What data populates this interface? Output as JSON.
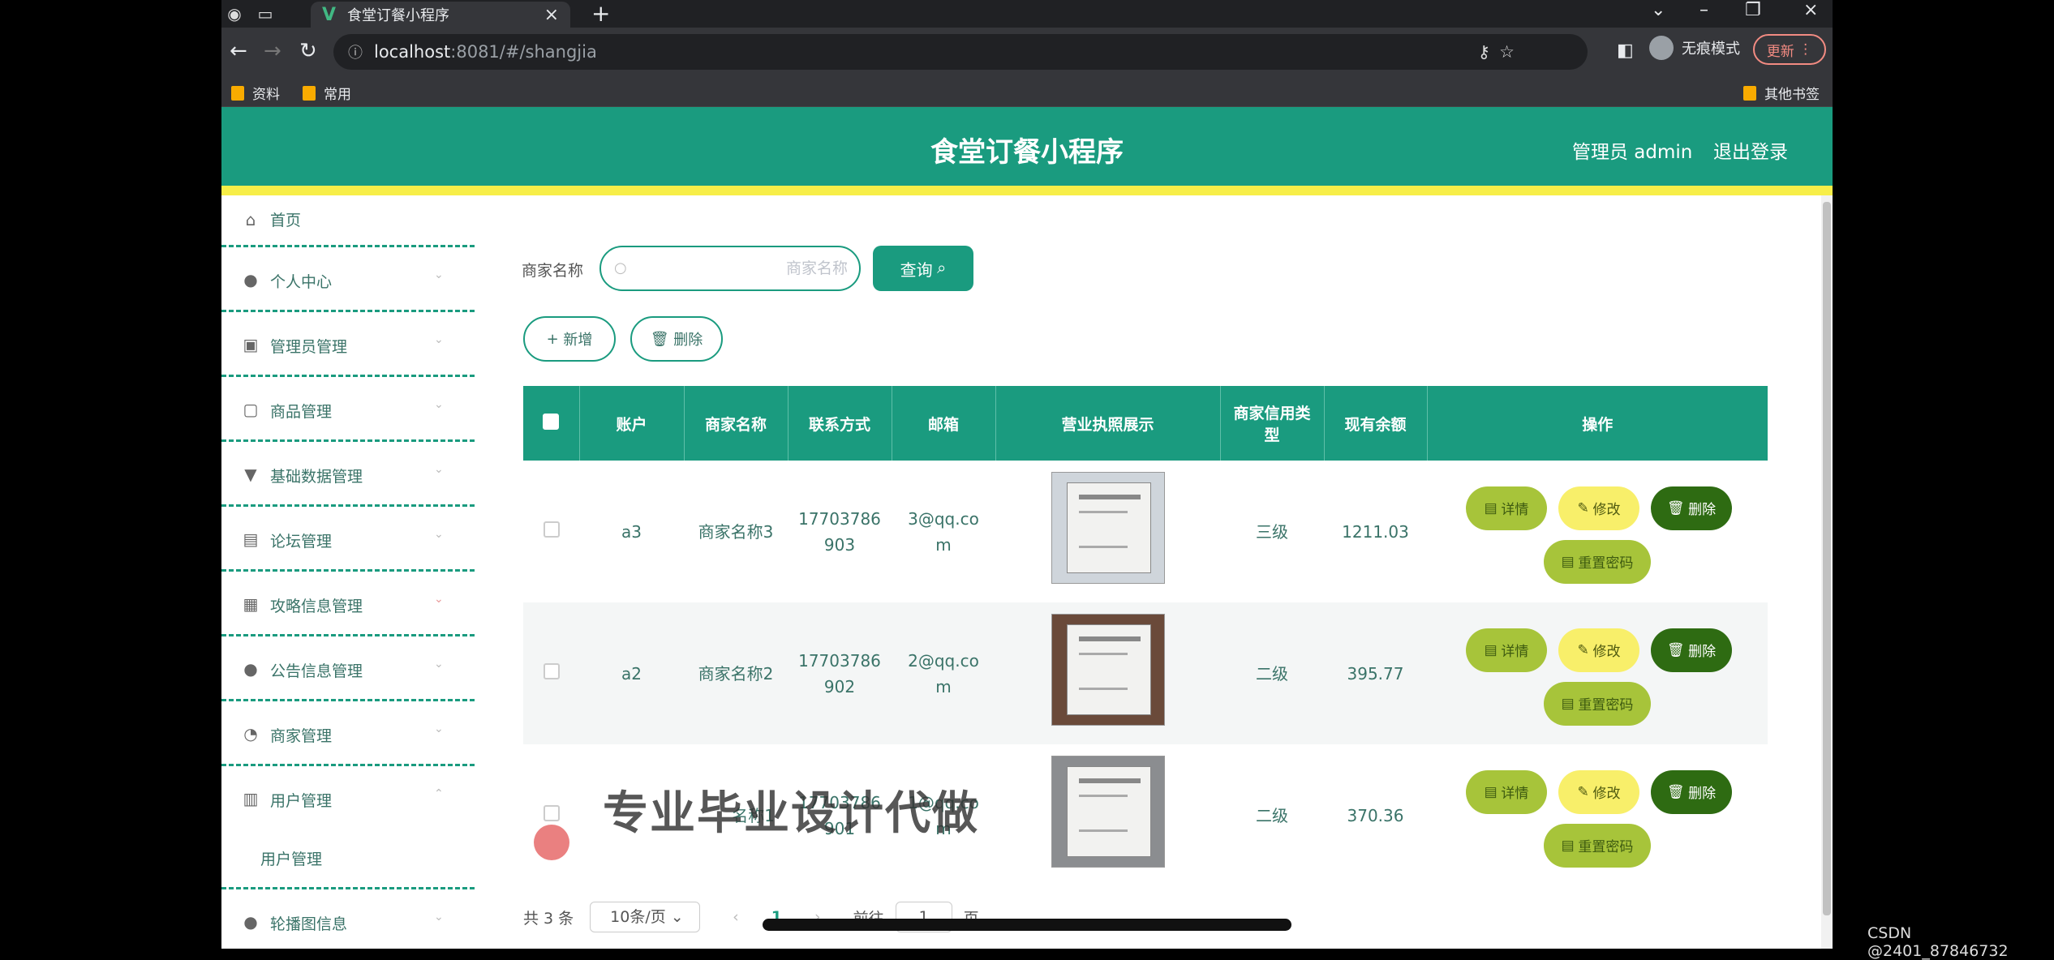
{
  "browser": {
    "tab_title": "食堂订餐小程序",
    "url_host": "localhost",
    "url_rest": ":8081/#/shangjia",
    "incognito_label": "无痕模式",
    "update_label": "更新",
    "bookmarks": [
      "资料",
      "常用"
    ],
    "other_bookmarks": "其他书签"
  },
  "header": {
    "title": "食堂订餐小程序",
    "admin": "管理员 admin",
    "logout": "退出登录"
  },
  "sidebar": {
    "items": [
      {
        "label": "首页",
        "icon": "home-icon"
      },
      {
        "label": "个人中心",
        "icon": "user-icon"
      },
      {
        "label": "管理员管理",
        "icon": "briefcase-icon"
      },
      {
        "label": "商品管理",
        "icon": "chat-icon"
      },
      {
        "label": "基础数据管理",
        "icon": "stamp-icon"
      },
      {
        "label": "论坛管理",
        "icon": "clipboard-icon"
      },
      {
        "label": "攻略信息管理",
        "icon": "list-icon"
      },
      {
        "label": "公告信息管理",
        "icon": "bulb-icon"
      },
      {
        "label": "商家管理",
        "icon": "gauge-icon"
      },
      {
        "label": "用户管理",
        "icon": "columns-icon"
      },
      {
        "label": "轮播图信息",
        "icon": "user-icon"
      }
    ],
    "subitem": "用户管理"
  },
  "search": {
    "label": "商家名称",
    "placeholder": "商家名称",
    "query_button": "查询"
  },
  "actions": {
    "add": "新增",
    "delete": "删除"
  },
  "table": {
    "columns": [
      "账户",
      "商家名称",
      "联系方式",
      "邮箱",
      "营业执照展示",
      "商家信用类型",
      "现有余额",
      "操作"
    ],
    "rows": [
      {
        "account": "a3",
        "name": "商家名称3",
        "phone_l1": "17703786",
        "phone_l2": "903",
        "email_l1": "3@qq.co",
        "email_l2": "m",
        "credit": "三级",
        "balance": "1211.03"
      },
      {
        "account": "a2",
        "name": "商家名称2",
        "phone_l1": "17703786",
        "phone_l2": "902",
        "email_l1": "2@qq.co",
        "email_l2": "m",
        "credit": "二级",
        "balance": "395.77"
      },
      {
        "account": "",
        "name": "名称1",
        "phone_l1": "17703786",
        "phone_l2": "901",
        "email_l1": "1@qq.co",
        "email_l2": "m",
        "credit": "二级",
        "balance": "370.36"
      }
    ],
    "ops": {
      "detail": "详情",
      "edit": "修改",
      "delete": "删除",
      "reset": "重置密码"
    }
  },
  "pager": {
    "total": "共 3 条",
    "per_page": "10条/页",
    "page": "1",
    "goto": "前往",
    "goto_value": "1",
    "page_unit": "页"
  },
  "overlay": {
    "watermark": "专业毕业设计代做",
    "credit": "CSDN @2401_87846732"
  }
}
